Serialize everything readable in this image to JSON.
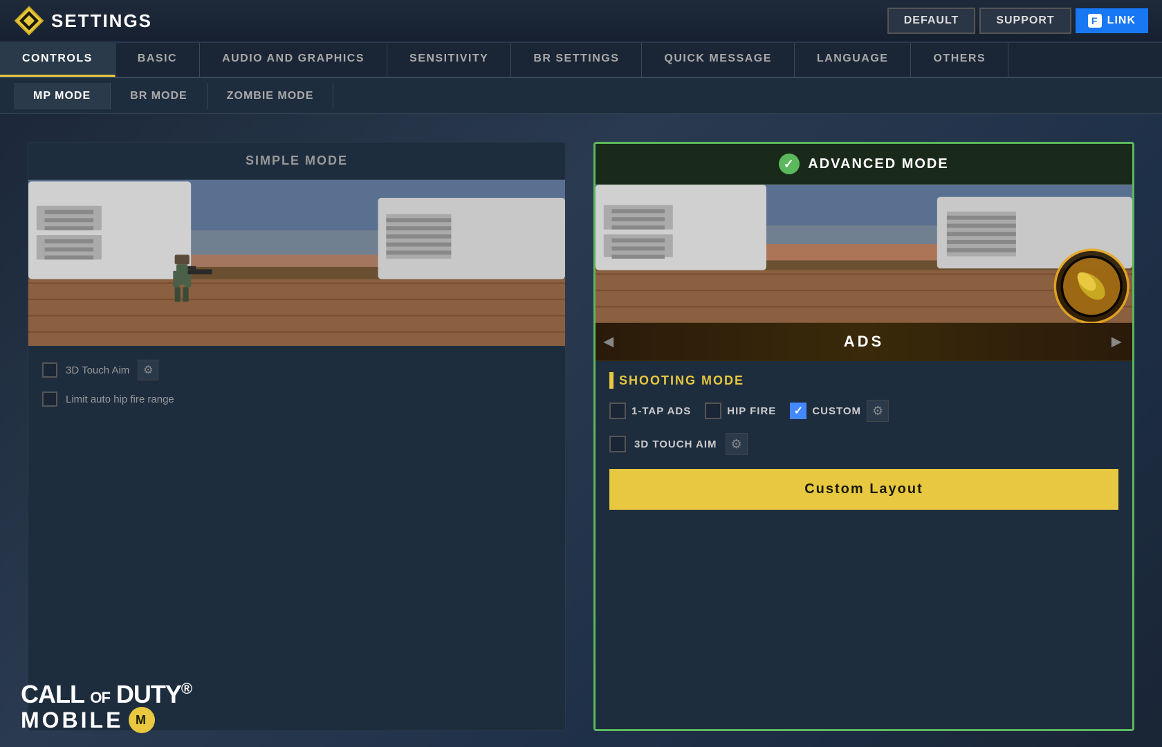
{
  "header": {
    "logo_text": "SETTINGS",
    "btn_default": "DEFAULT",
    "btn_support": "SUPPORT",
    "btn_link": "LINK",
    "fb_letter": "f"
  },
  "main_tabs": [
    {
      "id": "controls",
      "label": "CONTROLS",
      "active": true
    },
    {
      "id": "basic",
      "label": "BASIC",
      "active": false
    },
    {
      "id": "audio_graphics",
      "label": "AUDIO AND GRAPHICS",
      "active": false
    },
    {
      "id": "sensitivity",
      "label": "SENSITIVITY",
      "active": false
    },
    {
      "id": "br_settings",
      "label": "BR SETTINGS",
      "active": false
    },
    {
      "id": "quick_message",
      "label": "QUICK MESSAGE",
      "active": false
    },
    {
      "id": "language",
      "label": "LANGUAGE",
      "active": false
    },
    {
      "id": "others",
      "label": "OTHERS",
      "active": false
    }
  ],
  "sub_tabs": [
    {
      "id": "mp_mode",
      "label": "MP MODE",
      "active": true
    },
    {
      "id": "br_mode",
      "label": "BR MODE",
      "active": false
    },
    {
      "id": "zombie_mode",
      "label": "ZOMBIE MODE",
      "active": false
    }
  ],
  "simple_mode": {
    "title": "SIMPLE MODE",
    "option_3d_touch": "3D Touch Aim",
    "option_limit": "Limit auto hip fire range"
  },
  "advanced_mode": {
    "title": "ADVANCED MODE",
    "ads_label": "ADS",
    "shooting_mode_label": "SHOOTING MODE",
    "option_1tap": "1-tap ADS",
    "option_hipfire": "HIP FIRE",
    "option_custom": "CUSTOM",
    "option_3d_touch": "3D Touch Aim",
    "custom_layout_btn": "Custom Layout",
    "selected": true
  },
  "cod_logo": {
    "line1": "CALL",
    "line1_of": "OF",
    "line1_duty": "DUTY.",
    "line2": "MOBILE",
    "registered": "®"
  }
}
